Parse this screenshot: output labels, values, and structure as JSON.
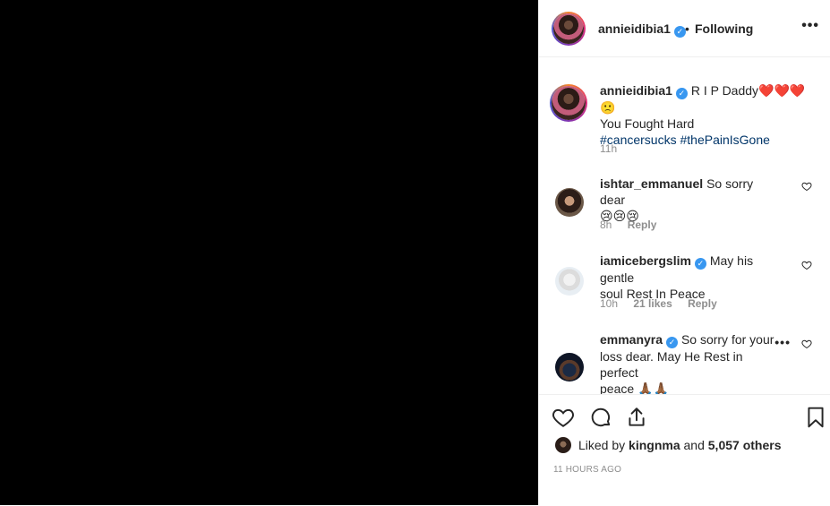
{
  "header": {
    "username": "annieidibia1",
    "separator": "•",
    "follow_status": "Following",
    "more": "•••"
  },
  "caption": {
    "username": "annieidibia1",
    "text_line1": "R I P Daddy❤️❤️❤️🙁",
    "text_line2": "You Fought Hard",
    "hashtags": [
      "#cancersucks",
      "#thePainIsGone"
    ],
    "time": "11h"
  },
  "comments": [
    {
      "username": "ishtar_emmanuel",
      "verified": false,
      "text": "So sorry dear",
      "text2": "😢😢😢",
      "time": "8h",
      "likes": "",
      "reply": "Reply"
    },
    {
      "username": "iamicebergslim",
      "verified": true,
      "text": "May his gentle",
      "text2": "soul Rest In Peace",
      "time": "10h",
      "likes": "21 likes",
      "reply": "Reply"
    },
    {
      "username": "emmanyra",
      "verified": true,
      "text": "So sorry for your",
      "text2": "loss dear. May He Rest in perfect",
      "text3": "peace 🙏🏾🙏🏾",
      "more": "•••"
    }
  ],
  "footer": {
    "liked_prefix": "Liked by",
    "liked_user": "kingnma",
    "liked_and": "and",
    "liked_others": "5,057 others",
    "timestamp": "11 HOURS AGO"
  },
  "icons": [
    "heart-icon",
    "comment-icon",
    "share-icon",
    "bookmark-icon",
    "verified-icon",
    "more-icon"
  ]
}
